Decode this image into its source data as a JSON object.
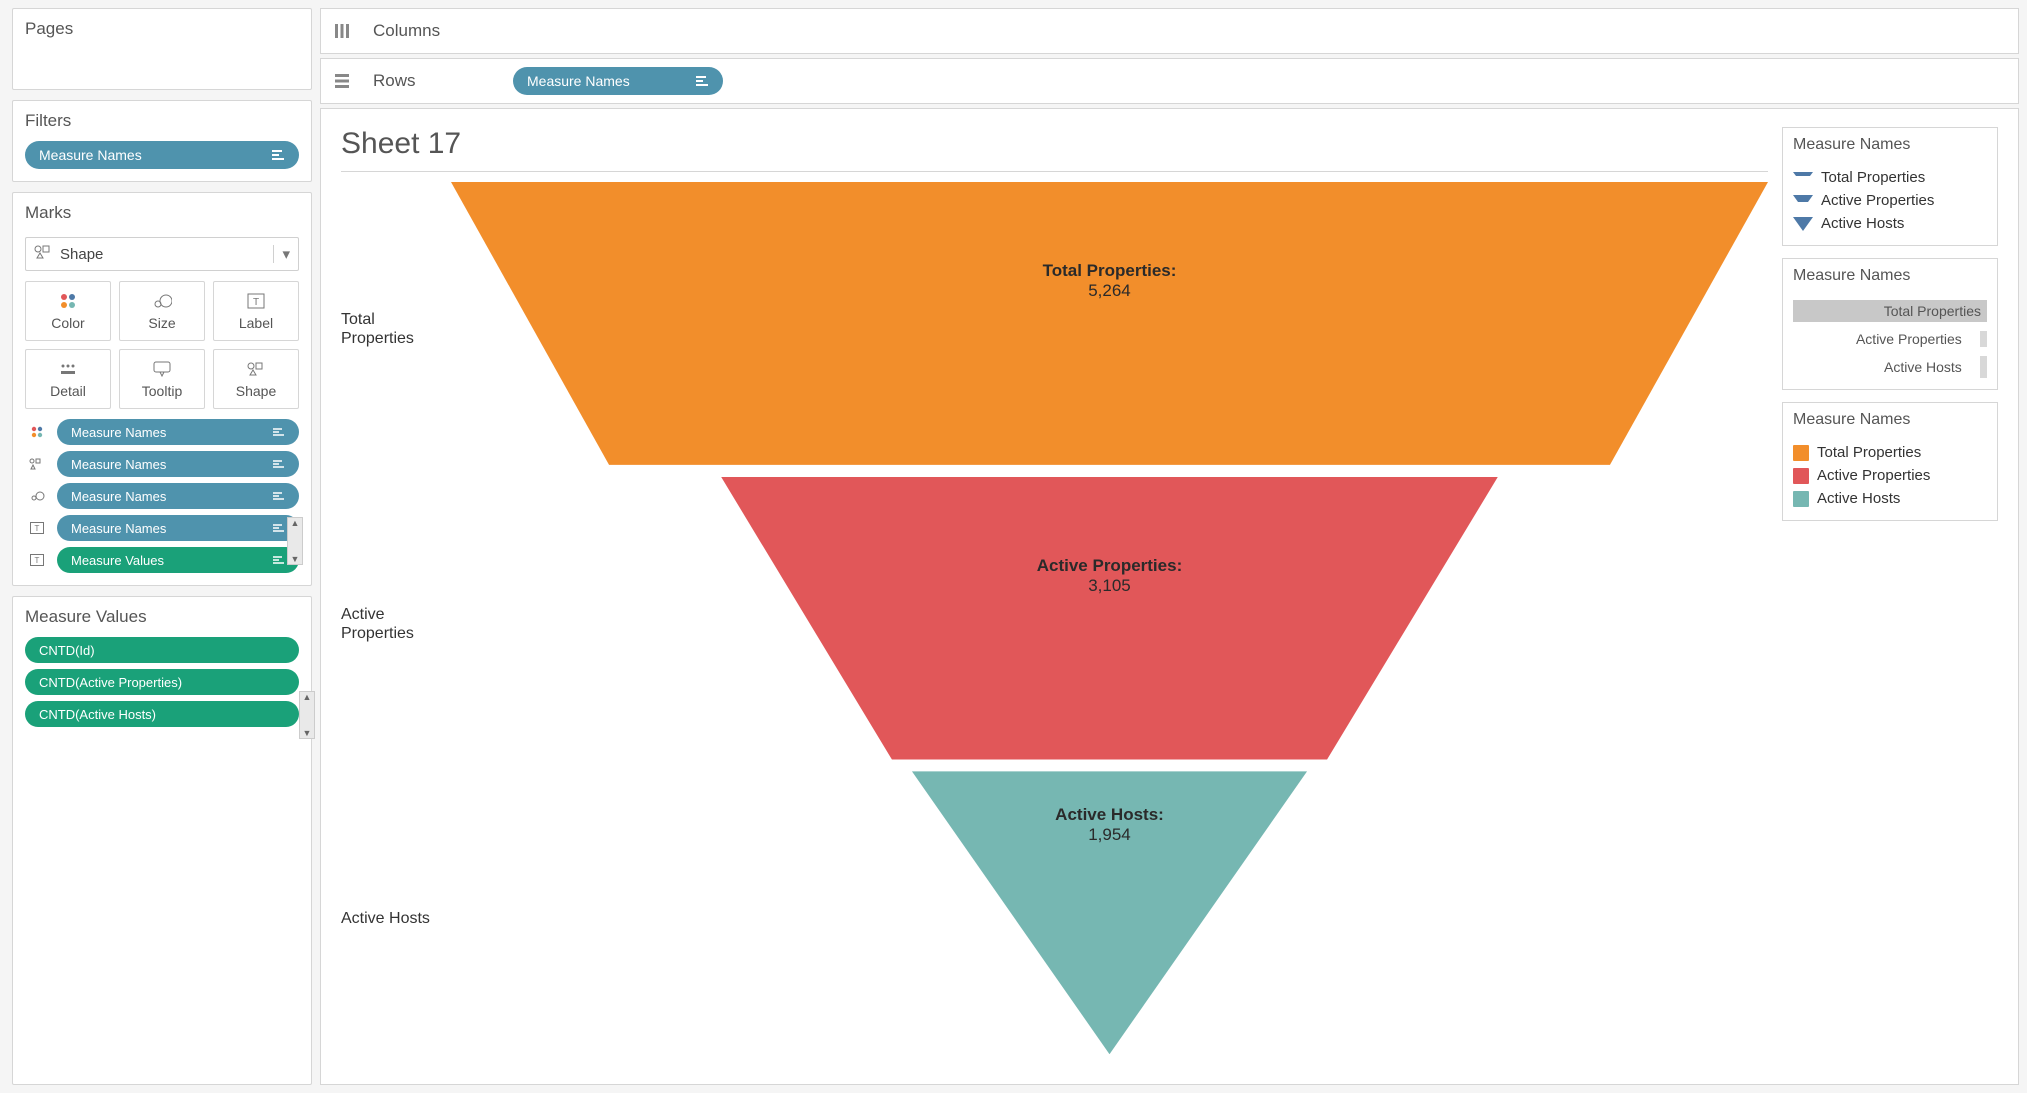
{
  "sidebar": {
    "pages_title": "Pages",
    "filters_title": "Filters",
    "filters_pill": "Measure Names",
    "marks_title": "Marks",
    "marks_select": "Shape",
    "mark_buttons": {
      "color": "Color",
      "size": "Size",
      "label": "Label",
      "detail": "Detail",
      "tooltip": "Tooltip",
      "shape": "Shape"
    },
    "mark_rows": [
      {
        "label": "Measure Names",
        "color": "blue"
      },
      {
        "label": "Measure Names",
        "color": "blue"
      },
      {
        "label": "Measure Names",
        "color": "blue"
      },
      {
        "label": "Measure Names",
        "color": "blue"
      },
      {
        "label": "Measure Values",
        "color": "green"
      }
    ],
    "mv_title": "Measure Values",
    "mv_rows": [
      "CNTD(Id)",
      "CNTD(Active Properties)",
      "CNTD(Active Hosts)"
    ]
  },
  "shelves": {
    "columns_label": "Columns",
    "rows_label": "Rows",
    "rows_pill": "Measure Names"
  },
  "viz": {
    "title": "Sheet 17"
  },
  "chart_data": {
    "type": "bar",
    "title": "Sheet 17",
    "xlabel": "",
    "ylabel": "",
    "categories": [
      "Total Properties",
      "Active Properties",
      "Active Hosts"
    ],
    "values": [
      5264,
      3105,
      1954
    ],
    "series": [
      {
        "name": "Total Properties",
        "label": "Total Properties:",
        "value": 5264,
        "display": "5,264",
        "color": "#f28e2b"
      },
      {
        "name": "Active Properties",
        "label": "Active Properties:",
        "value": 3105,
        "display": "3,105",
        "color": "#e15759"
      },
      {
        "name": "Active Hosts",
        "label": "Active Hosts:",
        "value": 1954,
        "display": "1,954",
        "color": "#76b7b2"
      }
    ]
  },
  "legends": {
    "shape": {
      "title": "Measure Names",
      "items": [
        "Total Properties",
        "Active Properties",
        "Active Hosts"
      ]
    },
    "size": {
      "title": "Measure Names",
      "items": [
        "Total Properties",
        "Active Properties",
        "Active Hosts"
      ]
    },
    "color": {
      "title": "Measure Names",
      "items": [
        {
          "label": "Total Properties",
          "color": "#f28e2b"
        },
        {
          "label": "Active Properties",
          "color": "#e15759"
        },
        {
          "label": "Active Hosts",
          "color": "#76b7b2"
        }
      ]
    }
  }
}
